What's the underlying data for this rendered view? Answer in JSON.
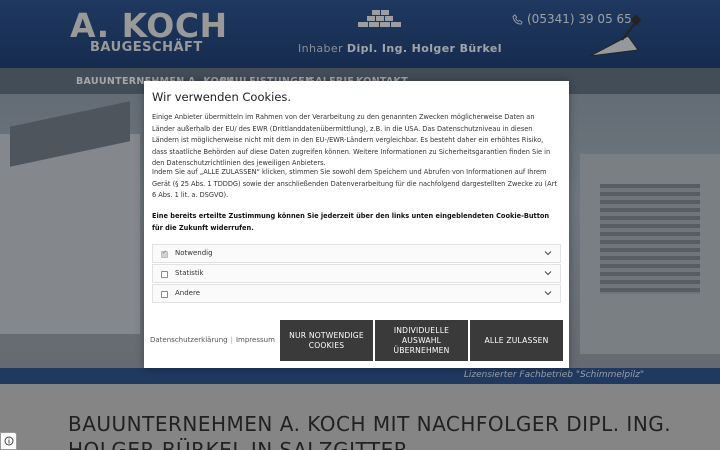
{
  "header": {
    "logo_main": "A. KOCH",
    "logo_sub": "BAUGESCHÄFT",
    "owner_prefix": "Inhaber",
    "owner_name": "Dipl. Ing. Holger Bürkel",
    "phone": "(05341) 39 05 65"
  },
  "nav": {
    "items": [
      "BAUUNTERNEHMEN A. KOCH",
      "BAULEISTUNGEN",
      "GALERIE",
      "KONTAKT"
    ]
  },
  "hero": {
    "tagline": "Lizensierter Fachbetrieb \"Schimmelpilz\""
  },
  "content": {
    "heading_line1": "BAUUNTERNEHMEN A. KOCH MIT NACHFOLGER DIPL. ING.",
    "heading_line2": "HOLGER BÜRKEL IN SALZGITTER"
  },
  "cookie_dialog": {
    "title": "Wir verwenden Cookies.",
    "paragraph1": "Einige Anbieter übermitteln im Rahmen von der Verarbeitung zu den genannten Zwecken möglicherweise Daten an Länder außerhalb der EU/ des EWR (Drittlanddatenübermittlung), z.B. in die USA. Das Datenschutzniveau in diesen Ländern ist möglicherweise nicht mit dem in den EU-/EWR-Ländern vergleichbar. Es besteht daher ein erhöhtes Risiko, dass staatliche Behörden auf diese Daten zugreifen können. Weitere Informationen zu Sicherheitsgarantien finden Sie in den Datenschutzrichtlinien des jeweiligen Anbieters.",
    "paragraph2": "Indem Sie auf „ALLE ZULASSEN“ klicken, stimmen Sie sowohl dem Speichern und Abrufen von Informationen auf Ihrem Gerät (§ 25 Abs. 1 TDDDG) sowie der anschließenden Datenverarbeitung für die nachfolgend dargestellten Zwecke zu (Art 6 Abs. 1 lit. a. DSGVO).",
    "paragraph3": "Eine bereits erteilte Zustimmung können Sie jederzeit über den links unten eingeblendeten Cookie-Button für die Zukunft widerrufen.",
    "categories": [
      {
        "label": "Notwendig",
        "checked": true
      },
      {
        "label": "Statistik",
        "checked": false
      },
      {
        "label": "Andere",
        "checked": false
      }
    ],
    "link_privacy": "Datenschutzerklärung",
    "link_separator": "|",
    "link_imprint": "Impressum",
    "btn_necessary": "NUR NOTWENDIGE COOKIES",
    "btn_individual": "INDIVIDUELLE AUSWAHL ÜBERNEHMEN",
    "btn_all": "ALLE ZULASSEN"
  },
  "colors": {
    "header_blue": "#2c4f86",
    "button_dark": "#3a3a3a"
  }
}
